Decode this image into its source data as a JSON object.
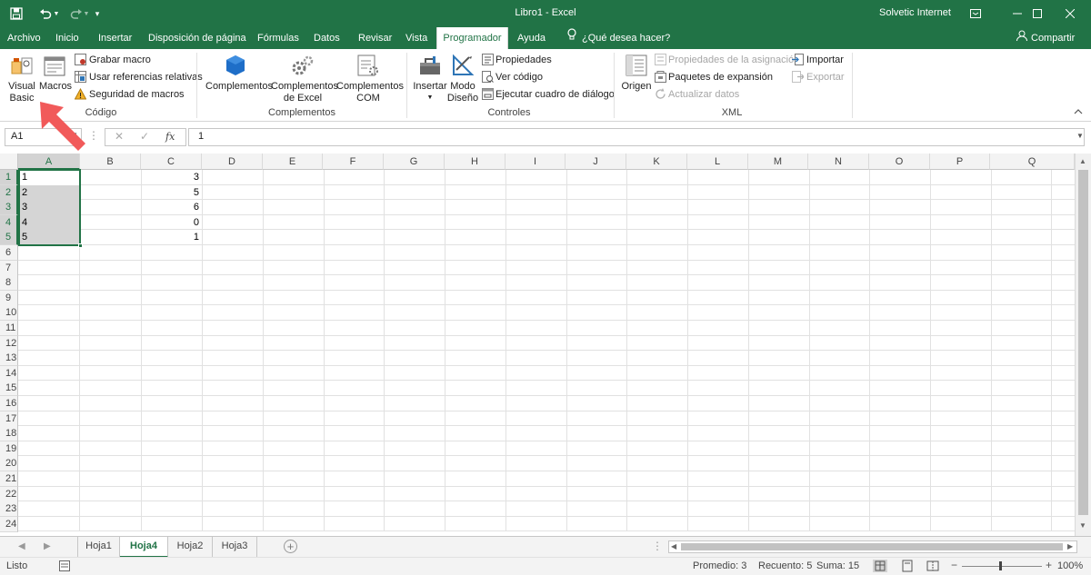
{
  "window": {
    "title": "Libro1  -  Excel",
    "user": "Solvetic Internet",
    "accent_color": "#217346"
  },
  "tabs": [
    {
      "label": "Archivo"
    },
    {
      "label": "Inicio"
    },
    {
      "label": "Insertar"
    },
    {
      "label": "Disposición de página"
    },
    {
      "label": "Fórmulas"
    },
    {
      "label": "Datos"
    },
    {
      "label": "Revisar"
    },
    {
      "label": "Vista"
    },
    {
      "label": "Programador",
      "active": true
    },
    {
      "label": "Ayuda"
    }
  ],
  "tell_me": "¿Qué desea hacer?",
  "share": "Compartir",
  "ribbon": {
    "codigo": {
      "label": "Código",
      "visual_basic": [
        "Visual",
        "Basic"
      ],
      "macros": "Macros",
      "grabar_macro": "Grabar macro",
      "usar_referencias": "Usar referencias relativas",
      "seguridad_macros": "Seguridad de macros"
    },
    "complementos": {
      "label": "Complementos",
      "complementos": "Complementos",
      "complementos_excel": [
        "Complementos",
        "de Excel"
      ],
      "complementos_com": [
        "Complementos",
        "COM"
      ]
    },
    "controles": {
      "label": "Controles",
      "insertar": "Insertar",
      "modo_diseno": [
        "Modo",
        "Diseño"
      ],
      "propiedades": "Propiedades",
      "ver_codigo": "Ver código",
      "ejecutar_cuadro": "Ejecutar cuadro de diálogo"
    },
    "xml": {
      "label": "XML",
      "origen": "Origen",
      "propiedades_asignacion": "Propiedades de la asignación",
      "paquetes_expansion": "Paquetes de expansión",
      "actualizar_datos": "Actualizar datos",
      "importar": "Importar",
      "exportar": "Exportar"
    }
  },
  "formula_bar": {
    "name_box": "A1",
    "fx": "fx",
    "value": "1"
  },
  "grid": {
    "columns": [
      "A",
      "B",
      "C",
      "D",
      "E",
      "F",
      "G",
      "H",
      "I",
      "J",
      "K",
      "L",
      "M",
      "N",
      "O",
      "P",
      "Q"
    ],
    "rows": [
      "1",
      "2",
      "3",
      "4",
      "5",
      "6",
      "7",
      "8",
      "9",
      "10",
      "11",
      "12",
      "13",
      "14",
      "15",
      "16",
      "17",
      "18",
      "19",
      "20",
      "21",
      "22",
      "23",
      "24"
    ],
    "column_a": [
      "1",
      "2",
      "3",
      "4",
      "5"
    ],
    "column_c": [
      "3",
      "5",
      "6",
      "0",
      "1"
    ]
  },
  "sheets": [
    {
      "label": "Hoja1"
    },
    {
      "label": "Hoja4",
      "active": true
    },
    {
      "label": "Hoja2"
    },
    {
      "label": "Hoja3"
    }
  ],
  "status": {
    "mode": "Listo",
    "promedio": "Promedio: 3",
    "recuento": "Recuento: 5",
    "suma": "Suma: 15",
    "zoom": "100%"
  }
}
